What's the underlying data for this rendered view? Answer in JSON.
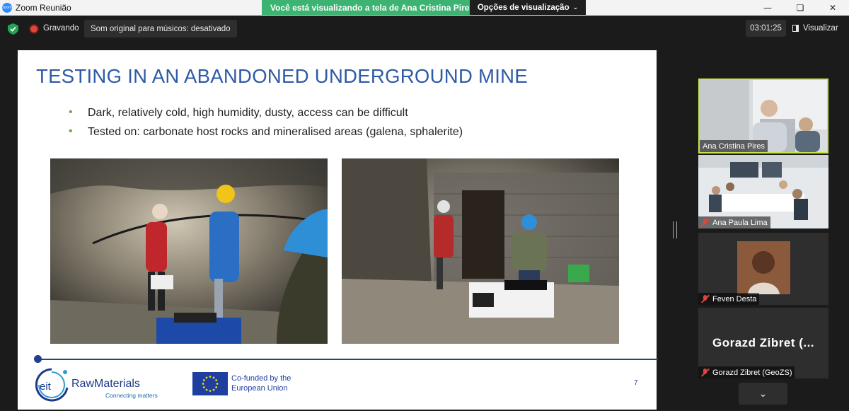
{
  "window": {
    "title": "Zoom Reunião",
    "app_icon_text": "zoom",
    "controls": [
      "minimize",
      "restore",
      "close"
    ]
  },
  "share_banner": {
    "message": "Você está visualizando a tela de Ana Cristina Pires",
    "options_label": "Opções de visualização"
  },
  "toolbar": {
    "recording_label": "Gravando",
    "audio_chip": "Som original para músicos: desativado",
    "timer": "03:01:25",
    "view_label": "Visualizar"
  },
  "slide": {
    "title": "TESTING IN AN ABANDONED UNDERGROUND MINE",
    "bullets": [
      "Dark, relatively cold, high humidity, dusty, access can be difficult",
      "Tested on: carbonate host rocks and mineralised areas (galena, sphalerite)"
    ],
    "brand": "RawMaterials",
    "brand_prefix": "eit",
    "tagline": "Connecting matters",
    "eu_line1": "Co-funded by the",
    "eu_line2": "European Union",
    "page_number": "7"
  },
  "participants": [
    {
      "name": "Ana Cristina Pires",
      "muted": false,
      "active_speaker": true
    },
    {
      "name": "Ana Paula Lima",
      "muted": true
    },
    {
      "name": "Feven Desta",
      "muted": true
    },
    {
      "name": "Gorazd Zibret (GeoZS)",
      "muted": true,
      "avatar_text": "Gorazd  Zibret  (..."
    }
  ],
  "colors": {
    "share_green": "#3cb371",
    "active_speaker_border": "#c8e34c",
    "slide_title": "#2e5aa6",
    "bullet": "#6aa84f"
  }
}
